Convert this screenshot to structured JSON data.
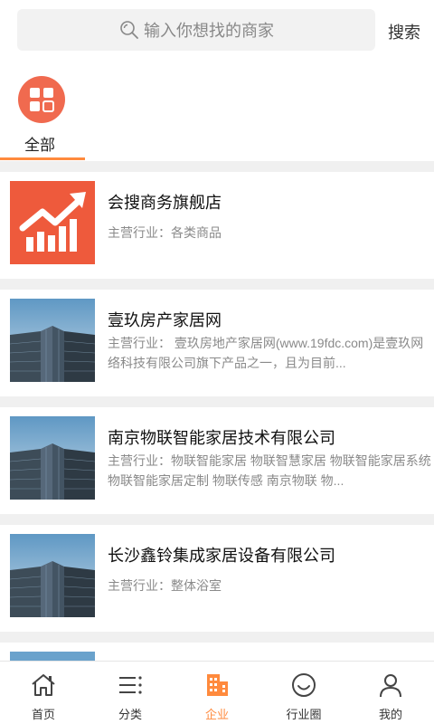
{
  "search": {
    "placeholder": "输入你想找的商家",
    "button_label": "搜索"
  },
  "categories": {
    "items": [
      {
        "label": "全部",
        "icon": "grid-icon",
        "color": "#f06a4f",
        "selected": true
      }
    ]
  },
  "listings": [
    {
      "title": "会搜商务旗舰店",
      "desc": "主营行业：各类商品",
      "thumb": "growth-chart-logo"
    },
    {
      "title": "壹玖房产家居网",
      "desc": "主营行业：  壹玖房地产家居网(www.19fdc.com)是壹玖网络科技有限公司旗下产品之一，且为目前...",
      "thumb": "skyscraper-photo"
    },
    {
      "title": "南京物联智能家居技术有限公司",
      "desc": "主营行业：物联智能家居 物联智慧家居 物联智能家居系统 物联智能家居定制 物联传感 南京物联  物...",
      "thumb": "skyscraper-photo"
    },
    {
      "title": "长沙鑫铃集成家居设备有限公司",
      "desc": "主营行业：整体浴室",
      "thumb": "skyscraper-photo"
    }
  ],
  "bottom_nav": [
    {
      "label": "首页",
      "icon": "home-icon"
    },
    {
      "label": "分类",
      "icon": "list-icon"
    },
    {
      "label": "企业",
      "icon": "company-icon",
      "active": true
    },
    {
      "label": "行业圈",
      "icon": "smiley-icon"
    },
    {
      "label": "我的",
      "icon": "user-icon"
    }
  ],
  "colors": {
    "accent": "#ff8a3d",
    "category_icon_bg": "#f06a4f",
    "divider": "#f0f0f0"
  }
}
